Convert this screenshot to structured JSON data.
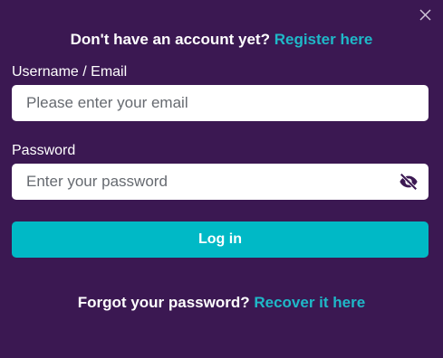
{
  "colors": {
    "background": "#3b1852",
    "accent": "#1fb8c8",
    "button": "#00b9c6",
    "text": "#ffffff",
    "eye_icon": "#3b1852"
  },
  "header": {
    "prompt_text": "Don't have an account yet?",
    "register_link": "Register here",
    "close_icon": "close-icon"
  },
  "form": {
    "username": {
      "label": "Username / Email",
      "value": "",
      "placeholder": "Please enter your email"
    },
    "password": {
      "label": "Password",
      "value": "",
      "placeholder": "Enter your password",
      "toggle_icon": "eye-slash-icon"
    },
    "login_label": "Log in"
  },
  "footer": {
    "prompt_text": "Forgot your password?",
    "recover_link": "Recover it here"
  }
}
